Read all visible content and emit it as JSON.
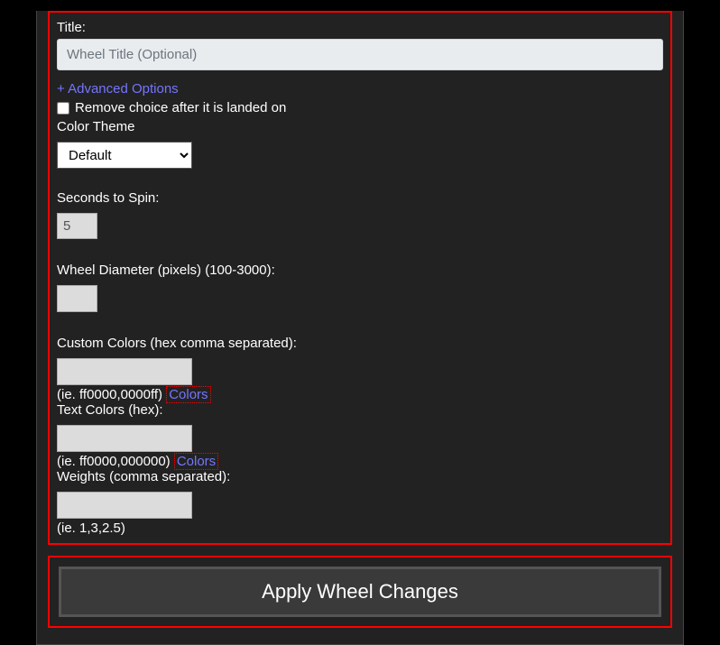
{
  "form": {
    "title_label": "Title:",
    "title_placeholder": "Wheel Title (Optional)",
    "title_value": "",
    "advanced_link": "+ Advanced Options",
    "remove_choice_label": "Remove choice after it is landed on",
    "remove_choice_checked": false,
    "color_theme_label": "Color Theme",
    "color_theme_value": "Default",
    "seconds_label": "Seconds to Spin:",
    "seconds_value": "5",
    "diameter_label": "Wheel Diameter (pixels) (100-3000):",
    "diameter_value": "",
    "custom_colors_label": "Custom Colors (hex comma separated):",
    "custom_colors_value": "",
    "custom_colors_hint_prefix": "(ie. ff0000,0000ff) ",
    "custom_colors_link": "Colors",
    "text_colors_label": "Text Colors (hex):",
    "text_colors_value": "",
    "text_colors_hint_prefix": "(ie. ff0000,000000) ",
    "text_colors_link": "Colors",
    "weights_label": "Weights (comma separated):",
    "weights_value": "",
    "weights_hint": "(ie. 1,3,2.5)"
  },
  "button": {
    "apply_label": "Apply Wheel Changes"
  }
}
